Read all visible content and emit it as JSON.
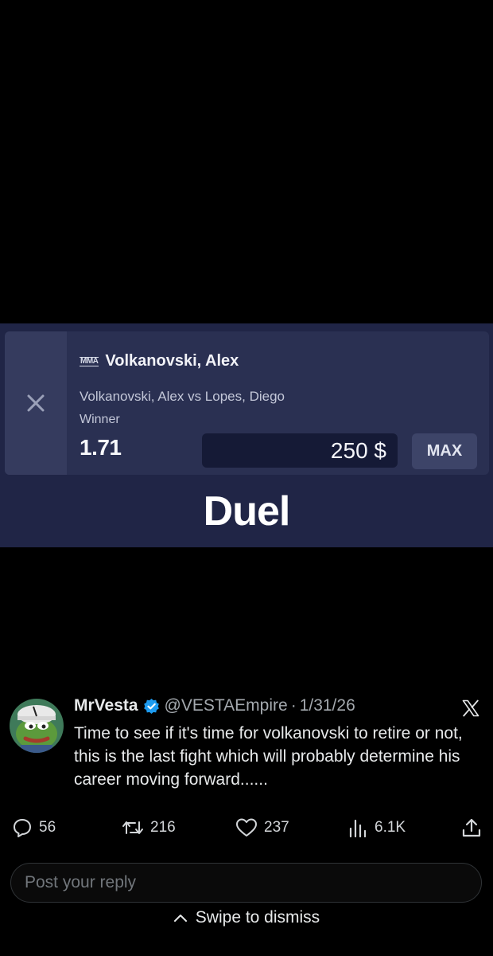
{
  "bet_slip": {
    "sport_icon": "mma-icon",
    "sport_icon_text": "MMA",
    "selection": "Volkanovski, Alex",
    "event": "Volkanovski, Alex vs Lopes, Diego",
    "market": "Winner",
    "odds": "1.71",
    "stake": "250 $",
    "max_label": "MAX",
    "brand": "Duel",
    "colors": {
      "background": "#202546",
      "card": "#2a3052",
      "stake_field": "#151a36"
    }
  },
  "tweet": {
    "display_name": "MrVesta",
    "verified": true,
    "handle": "@VESTAEmpire",
    "separator": "·",
    "date": "1/31/26",
    "text": "Time to see if it's time for volkanovski to retire or not, this is the last fight which will probably determine his career moving forward......",
    "actions": {
      "replies": "56",
      "reposts": "216",
      "likes": "237",
      "views": "6.1K"
    },
    "colors": {
      "verified": "#1d9bf0",
      "text": "#e7e9ea",
      "muted": "#a4a9ae"
    }
  },
  "reply": {
    "placeholder": "Post your reply"
  },
  "dismiss": {
    "label": "Swipe to dismiss"
  }
}
